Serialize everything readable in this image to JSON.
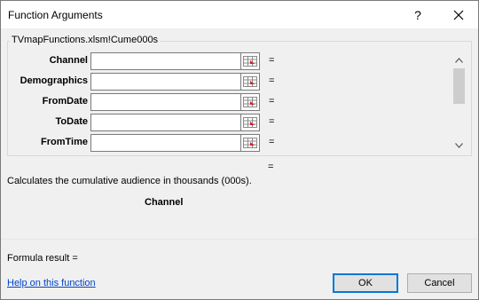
{
  "dialog": {
    "title": "Function Arguments",
    "help_glyph": "?",
    "close_glyph": "✕"
  },
  "function_group": {
    "label": "TVmapFunctions.xlsm!Cume000s",
    "rows": [
      {
        "label": "Channel",
        "value": "",
        "result": "="
      },
      {
        "label": "Demographics",
        "value": "",
        "result": "="
      },
      {
        "label": "FromDate",
        "value": "",
        "result": "="
      },
      {
        "label": "ToDate",
        "value": "",
        "result": "="
      },
      {
        "label": "FromTime",
        "value": "",
        "result": "="
      }
    ]
  },
  "function_result_eq": "=",
  "description": "Calculates the cumulative audience in thousands (000s).",
  "current_arg_name": "Channel",
  "formula_result_label": "Formula result =",
  "help_link": "Help on this function",
  "buttons": {
    "ok": "OK",
    "cancel": "Cancel"
  },
  "icons": {
    "picker": "collapse-range-icon",
    "scroll_up": "chevron-up-icon",
    "scroll_down": "chevron-down-icon"
  }
}
